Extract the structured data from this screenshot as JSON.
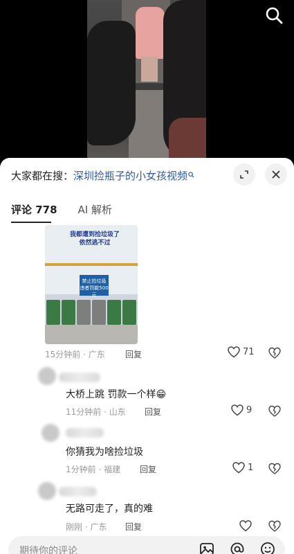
{
  "search_bar": {
    "prefix": "大家都在搜：",
    "query": "深圳捡瓶子的小女孩视频"
  },
  "tabs": [
    {
      "label": "评论 778"
    },
    {
      "label": "AI 解析"
    }
  ],
  "comment_image_text": {
    "meme_line1": "我都遭到捡垃圾了",
    "meme_line2": "依然逃不过",
    "sign_line1": "禁止捡垃圾",
    "sign_line2": "违者罚款500元"
  },
  "comments": [
    {
      "meta": "15分钟前 · 广东",
      "reply": "回复",
      "likes": "71",
      "text": ""
    },
    {
      "meta": "11分钟前 · 山东",
      "reply": "回复",
      "likes": "9",
      "text": "大桥上跳 罚款一个样😁"
    },
    {
      "meta": "1分钟前 · 福建",
      "reply": "回复",
      "likes": "1",
      "text": "你猜我为啥捡垃圾"
    },
    {
      "meta": "刚刚 · 广东",
      "reply": "回复",
      "likes": "",
      "text": "无路可走了，真的难"
    }
  ],
  "input": {
    "placeholder": "期待你的评论"
  },
  "icons": {
    "search": "search-icon",
    "expand": "expand-icon",
    "close": "close-icon",
    "heart": "heart-icon",
    "dislike": "broken-heart-icon",
    "image": "image-icon",
    "mention": "at-icon",
    "emoji": "emoji-icon"
  },
  "colors": {
    "link": "#2e5aa3",
    "meta": "#9a9a9a"
  }
}
